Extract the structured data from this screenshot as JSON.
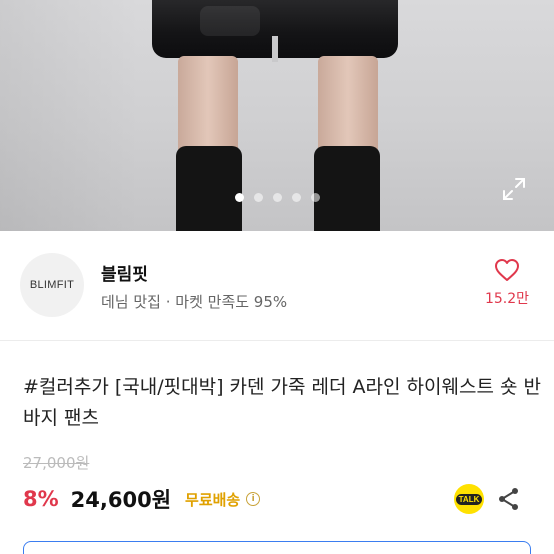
{
  "product_image": {
    "icon": "expand-icon",
    "carousel_dots": 5,
    "active_dot_index": 0
  },
  "shop": {
    "logo_text": "BLIMFIT",
    "name": "블림핏",
    "meta": "데님 맛집 · 마켓 만족도 95%",
    "like_icon": "heart-icon",
    "like_count": "15.2만"
  },
  "product": {
    "title": "#컬러추가 [국내/핏대박] 카덴 가죽 레더 A라인 하이웨스트 숏 반바지 팬츠",
    "original_price": "27,000원",
    "discount": "8%",
    "price": "24,600원",
    "shipping": "무료배송",
    "info_icon": "info-icon",
    "talk_label": "TALK",
    "share_icon": "share-icon"
  },
  "colors": {
    "accent_red": "#e0384c",
    "shipping_yellow": "#e0a100",
    "talk_yellow": "#ffe100",
    "bottom_button_border": "#3b7df0"
  }
}
